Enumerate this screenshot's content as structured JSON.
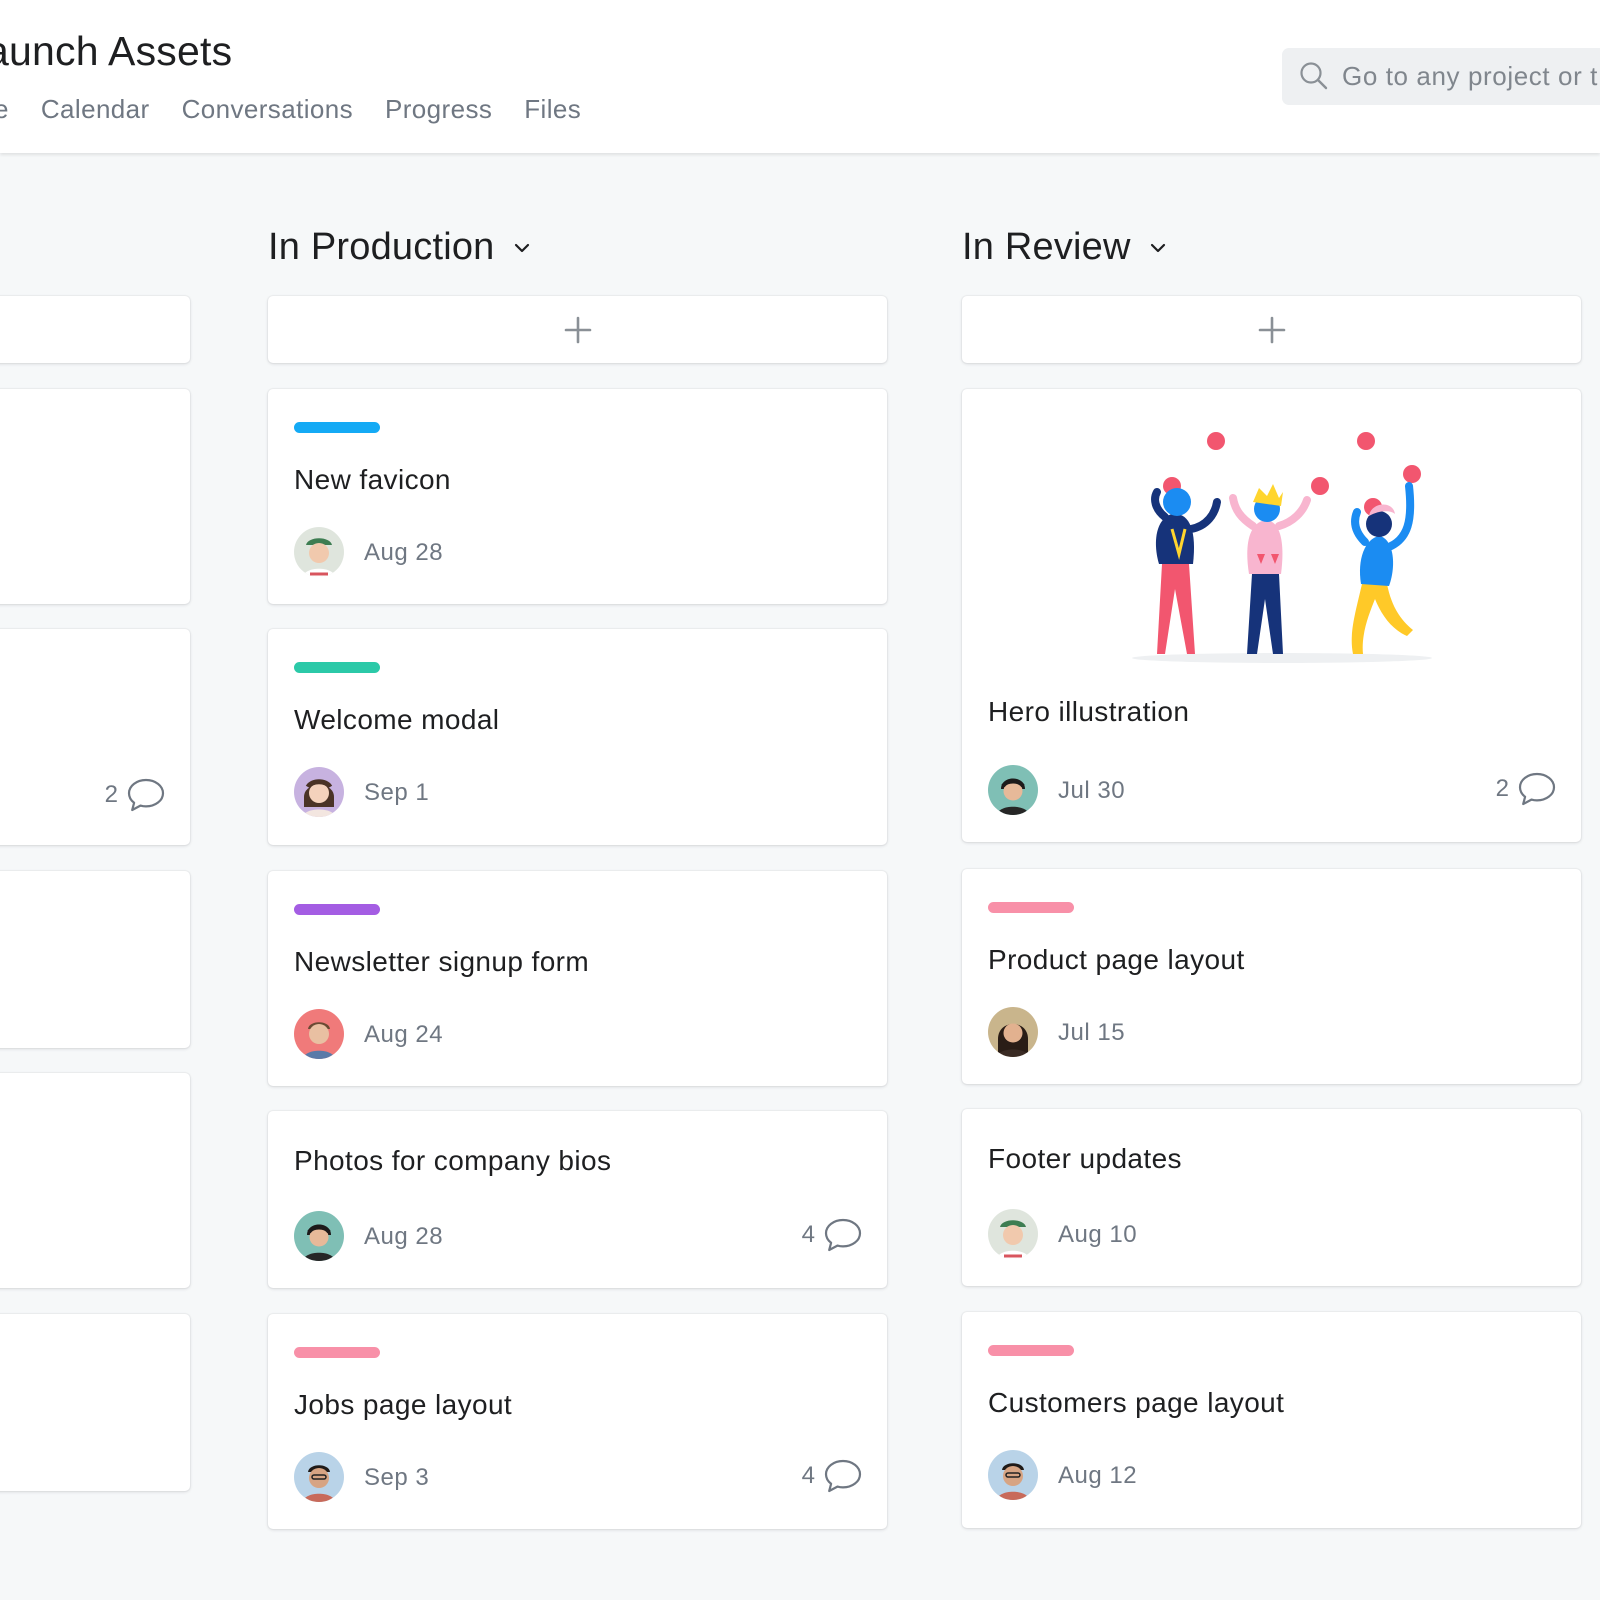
{
  "project": {
    "title": "aunch Assets"
  },
  "tabs": [
    "e",
    "Calendar",
    "Conversations",
    "Progress",
    "Files"
  ],
  "search": {
    "placeholder": "Go to any project or t"
  },
  "columns": [
    {
      "title": "",
      "cards": [
        {
          "comments": ""
        },
        {
          "comments": "2"
        },
        {
          "comments": ""
        },
        {
          "comments": ""
        },
        {
          "comments": ""
        }
      ]
    },
    {
      "title": "In Production",
      "cards": [
        {
          "tag_color": "#14aaf5",
          "title": "New favicon",
          "due": "Aug 28",
          "comments": ""
        },
        {
          "tag_color": "#2bc9a8",
          "title": "Welcome modal",
          "due": "Sep 1",
          "comments": ""
        },
        {
          "tag_color": "#a45de3",
          "title": "Newsletter signup form",
          "due": "Aug 24",
          "comments": ""
        },
        {
          "tag_color": "",
          "title": "Photos for company bios",
          "due": "Aug 28",
          "comments": "4"
        },
        {
          "tag_color": "#f890a8",
          "title": "Jobs page layout",
          "due": "Sep 3",
          "comments": "4"
        }
      ]
    },
    {
      "title": "In Review",
      "cards": [
        {
          "tag_color": "",
          "title": "Hero illustration",
          "due": "Jul 30",
          "comments": "2"
        },
        {
          "tag_color": "#f890a8",
          "title": "Product page layout",
          "due": "Jul 15",
          "comments": ""
        },
        {
          "tag_color": "",
          "title": "Footer updates",
          "due": "Aug 10",
          "comments": ""
        },
        {
          "tag_color": "#f890a8",
          "title": "Customers page layout",
          "due": "Aug 12",
          "comments": ""
        }
      ]
    }
  ],
  "colors": {
    "header_bg": "#ffffff",
    "board_bg": "#f6f8f9",
    "text_primary": "#1e1f21",
    "text_secondary": "#6f7782"
  },
  "icons": [
    "search-icon",
    "chevron-down-icon",
    "plus-icon",
    "comment-icon",
    "avatar"
  ]
}
